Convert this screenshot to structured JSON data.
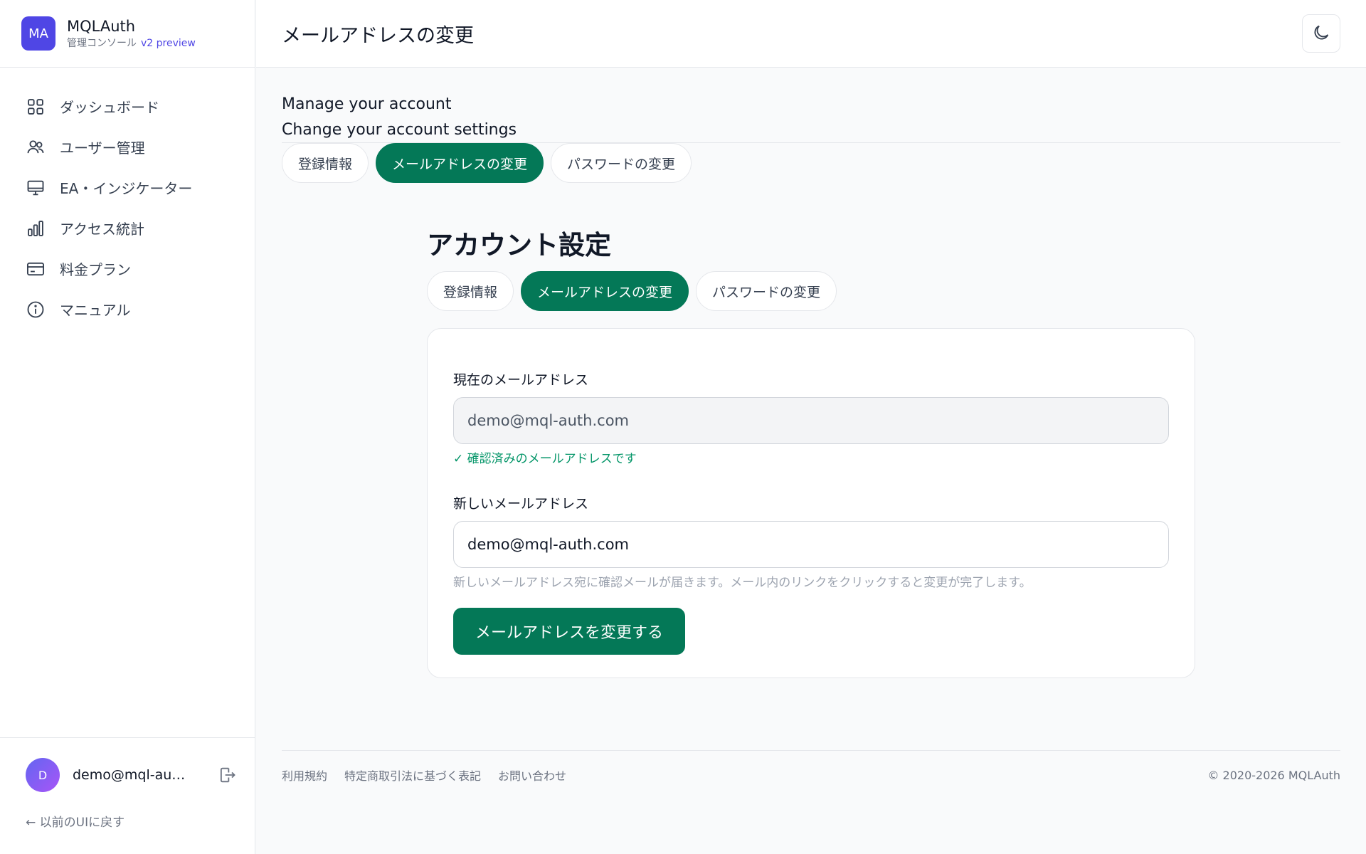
{
  "brand": {
    "logo_initials": "MA",
    "name": "MQLAuth",
    "subtitle": "管理コンソール",
    "version": "v2 preview"
  },
  "sidebar": {
    "items": [
      {
        "label": "ダッシュボード",
        "icon": "grid-icon"
      },
      {
        "label": "ユーザー管理",
        "icon": "users-icon"
      },
      {
        "label": "EA・インジケーター",
        "icon": "monitor-icon"
      },
      {
        "label": "アクセス統計",
        "icon": "bar-chart-icon"
      },
      {
        "label": "料金プラン",
        "icon": "credit-card-icon"
      },
      {
        "label": "マニュアル",
        "icon": "info-icon"
      }
    ],
    "user": {
      "avatar_initial": "D",
      "email": "demo@mql-auth.com"
    },
    "back_link": "← 以前のUIに戻す"
  },
  "header": {
    "title": "メールアドレスの変更",
    "theme_icon": "moon-icon"
  },
  "main": {
    "manage_title": "Manage your account",
    "manage_subtitle": "Change your account settings",
    "tabs": [
      {
        "label": "登録情報",
        "active": false
      },
      {
        "label": "メールアドレスの変更",
        "active": true
      },
      {
        "label": "パスワードの変更",
        "active": false
      }
    ],
    "account_title": "アカウント設定",
    "form": {
      "current_label": "現在のメールアドレス",
      "current_value": "demo@mql-auth.com",
      "verified_text": "✓ 確認済みのメールアドレスです",
      "new_label": "新しいメールアドレス",
      "new_value": "demo@mql-auth.com",
      "hint": "新しいメールアドレス宛に確認メールが届きます。メール内のリンクをクリックすると変更が完了します。",
      "submit_label": "メールアドレスを変更する"
    }
  },
  "footer": {
    "links": [
      "利用規約",
      "特定商取引法に基づく表記",
      "お問い合わせ"
    ],
    "copyright": "© 2020-2026 MQLAuth"
  },
  "colors": {
    "accent": "#047857",
    "brand": "#4f46e5",
    "verified": "#059669"
  }
}
